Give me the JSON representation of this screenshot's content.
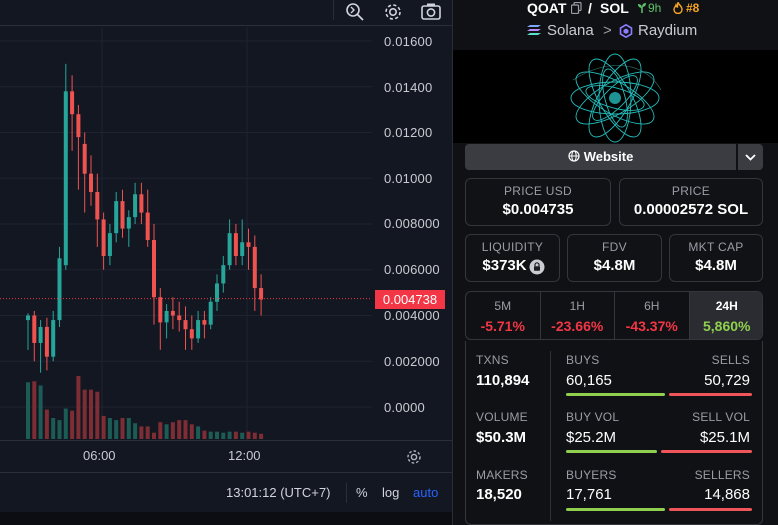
{
  "chart": {
    "price_axis": [
      "0.01600",
      "0.01400",
      "0.01200",
      "0.01000",
      "0.008000",
      "0.006000",
      "0.004000",
      "0.002000",
      "0.0000"
    ],
    "current_price": "0.004738",
    "time_axis": [
      "06:00",
      "12:00"
    ],
    "clock": "13:01:12 (UTC+7)",
    "percent_label": "%",
    "log_label": "log",
    "auto_label": "auto",
    "colors": {
      "up": "#26a69a",
      "down": "#ef5350",
      "up_volume": "#1d5c55",
      "down_volume": "#7d2d33",
      "background": "#131722"
    }
  },
  "chart_data": {
    "type": "candlestick",
    "ylim": [
      0.0,
      0.0165
    ],
    "candles": [
      [
        0.0038,
        0.0041,
        0.0025,
        0.004
      ],
      [
        0.004,
        0.0042,
        0.002,
        0.0028
      ],
      [
        0.0028,
        0.0038,
        0.0015,
        0.0035
      ],
      [
        0.0035,
        0.0039,
        0.0016,
        0.0022
      ],
      [
        0.0022,
        0.0042,
        0.002,
        0.0038
      ],
      [
        0.0038,
        0.007,
        0.0035,
        0.0065
      ],
      [
        0.0062,
        0.015,
        0.006,
        0.0138
      ],
      [
        0.0138,
        0.0145,
        0.0112,
        0.0128
      ],
      [
        0.0128,
        0.0132,
        0.0095,
        0.0118
      ],
      [
        0.0115,
        0.012,
        0.0085,
        0.0102
      ],
      [
        0.0102,
        0.011,
        0.0088,
        0.0094
      ],
      [
        0.0094,
        0.0102,
        0.007,
        0.0082
      ],
      [
        0.0082,
        0.0085,
        0.006,
        0.0066
      ],
      [
        0.0066,
        0.008,
        0.0062,
        0.0076
      ],
      [
        0.0076,
        0.0094,
        0.0072,
        0.009
      ],
      [
        0.009,
        0.0095,
        0.0074,
        0.0078
      ],
      [
        0.0078,
        0.0086,
        0.007,
        0.0083
      ],
      [
        0.0083,
        0.0098,
        0.008,
        0.0093
      ],
      [
        0.0093,
        0.0098,
        0.008,
        0.0085
      ],
      [
        0.0085,
        0.0095,
        0.007,
        0.0073
      ],
      [
        0.0073,
        0.008,
        0.0036,
        0.0048
      ],
      [
        0.0048,
        0.0052,
        0.0025,
        0.0037
      ],
      [
        0.0037,
        0.0045,
        0.003,
        0.0042
      ],
      [
        0.0042,
        0.0048,
        0.0034,
        0.004
      ],
      [
        0.004,
        0.0046,
        0.0033,
        0.0038
      ],
      [
        0.0038,
        0.0044,
        0.0025,
        0.0034
      ],
      [
        0.0034,
        0.004,
        0.0025,
        0.003
      ],
      [
        0.003,
        0.0042,
        0.0028,
        0.0038
      ],
      [
        0.0038,
        0.0042,
        0.003,
        0.0036
      ],
      [
        0.0036,
        0.0048,
        0.0034,
        0.0046
      ],
      [
        0.0046,
        0.0058,
        0.0042,
        0.0054
      ],
      [
        0.0054,
        0.0066,
        0.005,
        0.0062
      ],
      [
        0.0062,
        0.0082,
        0.006,
        0.0076
      ],
      [
        0.0076,
        0.008,
        0.0062,
        0.0066
      ],
      [
        0.0066,
        0.0082,
        0.0062,
        0.0072
      ],
      [
        0.0072,
        0.0078,
        0.006,
        0.007
      ],
      [
        0.007,
        0.0075,
        0.0042,
        0.0052
      ],
      [
        0.0052,
        0.0058,
        0.004,
        0.0047
      ]
    ],
    "volumes": [
      54,
      55,
      51,
      28,
      20,
      18,
      29,
      27,
      60,
      47,
      47,
      45,
      22,
      20,
      18,
      20,
      20,
      15,
      12,
      12,
      6,
      16,
      14,
      16,
      18,
      18,
      14,
      12,
      8,
      7,
      7,
      6,
      7,
      7,
      6,
      7,
      6,
      5
    ]
  },
  "pair": {
    "base": "QOAT",
    "separator": "/",
    "quote": "SOL",
    "age": "9h",
    "rank": "#8"
  },
  "chain": {
    "network": "Solana",
    "separator": ">",
    "dex": "Raydium"
  },
  "website": {
    "label": "Website"
  },
  "price_usd": {
    "label": "PRICE USD",
    "value": "$0.004735"
  },
  "price_sol": {
    "label": "PRICE",
    "value": "0.00002572 SOL"
  },
  "liquidity": {
    "label": "LIQUIDITY",
    "value": "$373K"
  },
  "fdv": {
    "label": "FDV",
    "value": "$4.8M"
  },
  "mkt_cap": {
    "label": "MKT CAP",
    "value": "$4.8M"
  },
  "tabs": [
    {
      "label": "5M",
      "value": "-5.71%",
      "color": "#f23645"
    },
    {
      "label": "1H",
      "value": "-23.66%",
      "color": "#f23645"
    },
    {
      "label": "6H",
      "value": "-43.37%",
      "color": "#f23645"
    },
    {
      "label": "24H",
      "value": "5,860%",
      "color": "#8fd14f"
    }
  ],
  "stats": {
    "txns": {
      "label": "TXNS",
      "value": "110,894"
    },
    "buys": {
      "label": "BUYS",
      "value": "60,165"
    },
    "sells": {
      "label": "SELLS",
      "value": "50,729"
    },
    "volume": {
      "label": "VOLUME",
      "value": "$50.3M"
    },
    "buy_vol": {
      "label": "BUY VOL",
      "value": "$25.2M"
    },
    "sell_vol": {
      "label": "SELL VOL",
      "value": "$25.1M"
    },
    "makers": {
      "label": "MAKERS",
      "value": "18,520"
    },
    "buyers": {
      "label": "BUYERS",
      "value": "17,761"
    },
    "sellers": {
      "label": "SELLERS",
      "value": "14,868"
    }
  },
  "ratios": {
    "buys": 0.5425,
    "buy_vol": 0.501,
    "buyers": 0.544
  },
  "colors": {
    "buy": "#8fd14f",
    "sell": "#f0555a"
  }
}
